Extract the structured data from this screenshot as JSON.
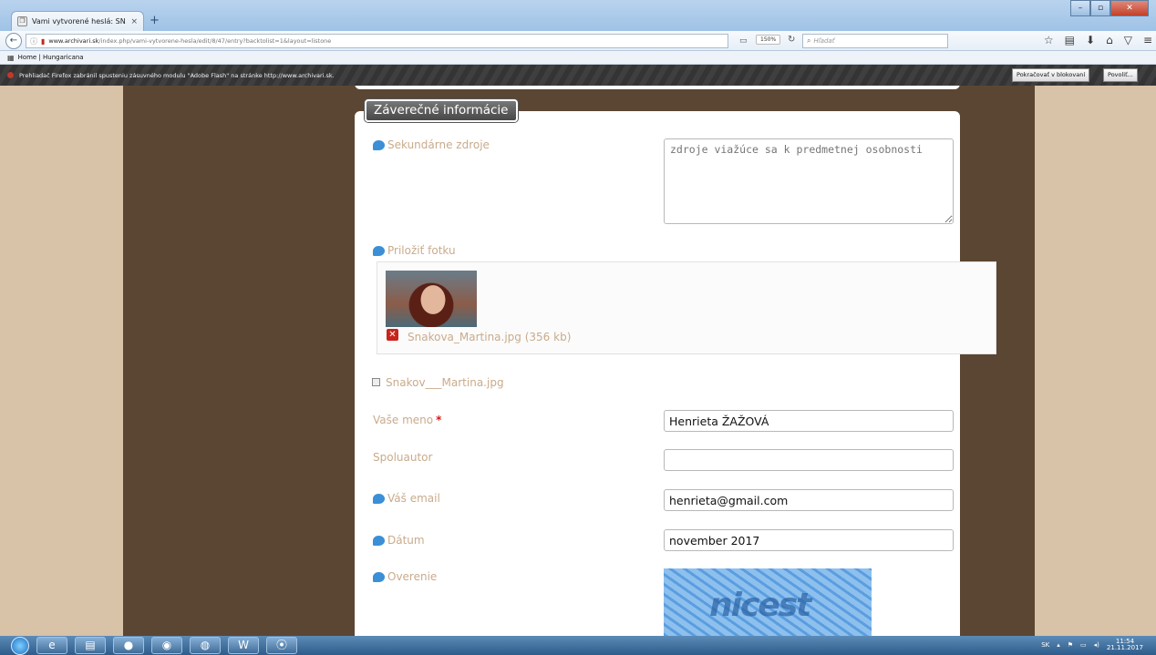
{
  "browser": {
    "tab_title": "Vami vytvorené heslá: SNA...",
    "tab_close": "×",
    "new_tab": "+",
    "url_domain": "www.archivari.sk",
    "url_path": "/index.php/vami-vytvorene-hesla/edit/8/47/entry?backtolist=1&layout=listone",
    "zoom": "150%",
    "search_placeholder": "Hľadať",
    "bookmark": "Home | Hungaricana",
    "flash_message": "Prehliadač Firefox zabránil spusteniu zásuvného modulu \"Adobe Flash\" na stránke http://www.archivari.sk.",
    "flash_continue": "Pokračovať v blokovaní",
    "flash_allow": "Povoliť..."
  },
  "form": {
    "section_title": "Záverečné informácie",
    "secondary_sources": {
      "label": "Sekundárne zdroje",
      "placeholder": "zdroje viažúce sa k predmetnej osobnosti"
    },
    "photo": {
      "label": "Priložiť fotku",
      "file": "Snakova_Martina.jpg (356 kb)"
    },
    "checkbox_label": "Snakov___Martina.jpg",
    "name": {
      "label": "Vaše meno",
      "required_mark": "*",
      "value": "Henrieta ŽAŽOVÁ"
    },
    "coauthor": {
      "label": "Spoluautor",
      "value": ""
    },
    "email": {
      "label": "Váš email",
      "value": "henrieta@gmail.com"
    },
    "date": {
      "label": "Dátum",
      "value": "november 2017"
    },
    "verification": {
      "label": "Overenie",
      "captcha_text": "nicest"
    }
  },
  "taskbar": {
    "lang": "SK",
    "time": "11:54",
    "date": "21.11.2017"
  },
  "colors": {
    "label": "#c9ab8c",
    "page_bg": "#d8c2a8",
    "wrapper_bg": "#5b4633",
    "required": "#d31616",
    "info_icon": "#3a8fd6"
  }
}
